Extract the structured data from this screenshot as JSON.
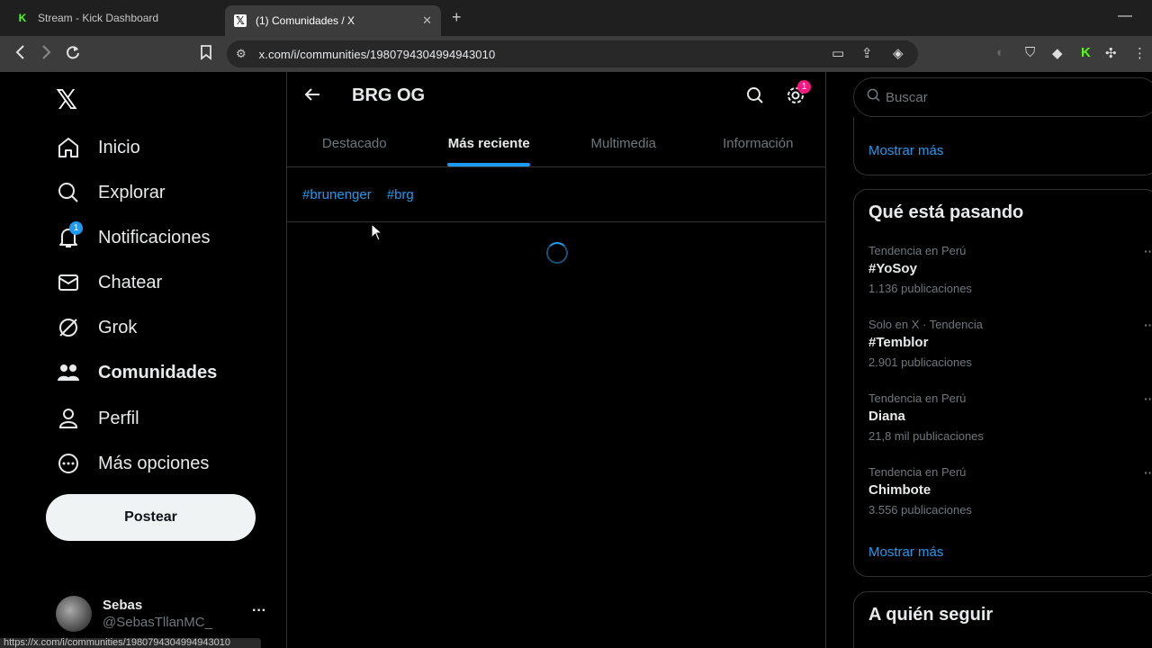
{
  "browser": {
    "tabs": [
      {
        "title": "Stream - Kick Dashboard",
        "icon": "kick-icon"
      },
      {
        "title": "(1) Comunidades / X",
        "icon": "x-icon"
      }
    ],
    "url": "x.com/i/communities/1980794304994943010",
    "status_url": "https://x.com/i/communities/1980794304994943010"
  },
  "sidebar": {
    "items": [
      {
        "label": "Inicio",
        "icon": "home-icon"
      },
      {
        "label": "Explorar",
        "icon": "search-icon"
      },
      {
        "label": "Notificaciones",
        "icon": "bell-icon",
        "badge": "1"
      },
      {
        "label": "Chatear",
        "icon": "mail-icon"
      },
      {
        "label": "Grok",
        "icon": "grok-icon"
      },
      {
        "label": "Comunidades",
        "icon": "communities-icon"
      },
      {
        "label": "Perfil",
        "icon": "person-icon"
      },
      {
        "label": "Más opciones",
        "icon": "more-circle-icon"
      }
    ],
    "post_label": "Postear",
    "user": {
      "name": "Sebas",
      "handle": "@SebasTllanMC_"
    }
  },
  "main": {
    "title": "BRG OG",
    "settings_badge": "1",
    "tabs": [
      "Destacado",
      "Más reciente",
      "Multimedia",
      "Información"
    ],
    "active_tab": "Más reciente",
    "hashtags": [
      "#brunenger",
      "#brg"
    ]
  },
  "right": {
    "search_placeholder": "Buscar",
    "show_more_top": "Mostrar más",
    "trends_title": "Qué está pasando",
    "trends": [
      {
        "context": "Tendencia en Perú",
        "name": "#YoSoy",
        "count": "1.136 publicaciones"
      },
      {
        "context": "Solo en X · Tendencia",
        "name": "#Temblor",
        "count": "2.901 publicaciones"
      },
      {
        "context": "Tendencia en Perú",
        "name": "Diana",
        "count": "21,8 mil publicaciones"
      },
      {
        "context": "Tendencia en Perú",
        "name": "Chimbote",
        "count": "3.556 publicaciones"
      }
    ],
    "show_more_trends": "Mostrar más",
    "follow_title": "A quién seguir"
  },
  "colors": {
    "accent": "#1d9bf0",
    "badge_pink": "#f91880",
    "background": "#000000",
    "border": "#2f3336"
  }
}
